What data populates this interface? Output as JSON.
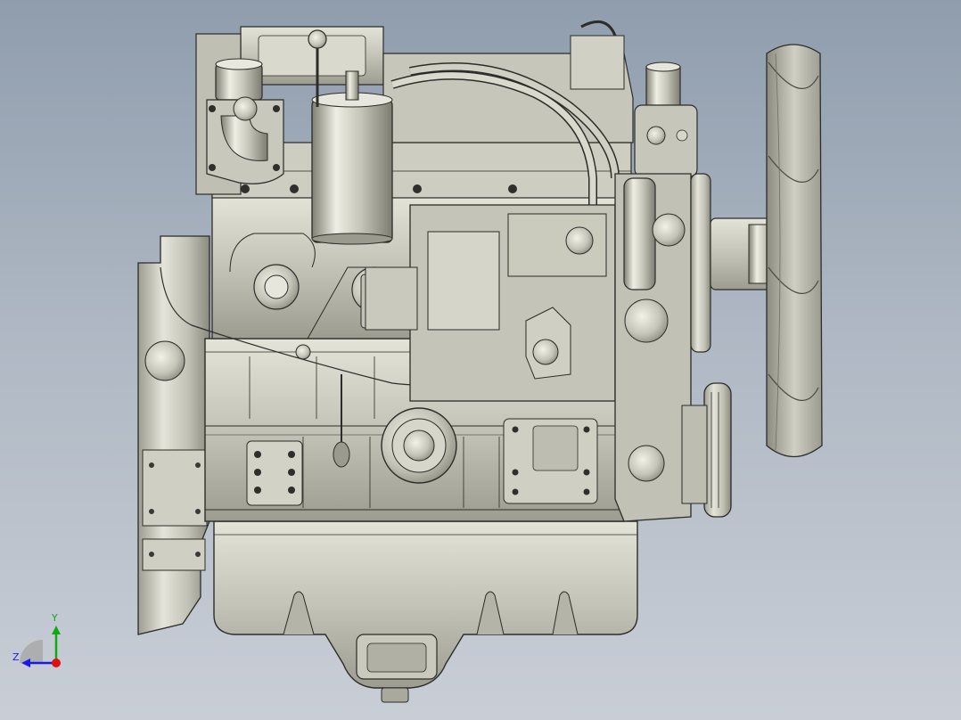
{
  "viewport": {
    "background_top": "#8f9dad",
    "background_bottom": "#c9ced6",
    "model_color": "#c8c8bc",
    "model_shadow": "#8d8d80",
    "edge_color": "#2c2c2a"
  },
  "triad": {
    "y_label": "Y",
    "z_label": "Z",
    "y_color": "#11a811",
    "z_color": "#1a1ae8",
    "x_color": "#e01010"
  }
}
